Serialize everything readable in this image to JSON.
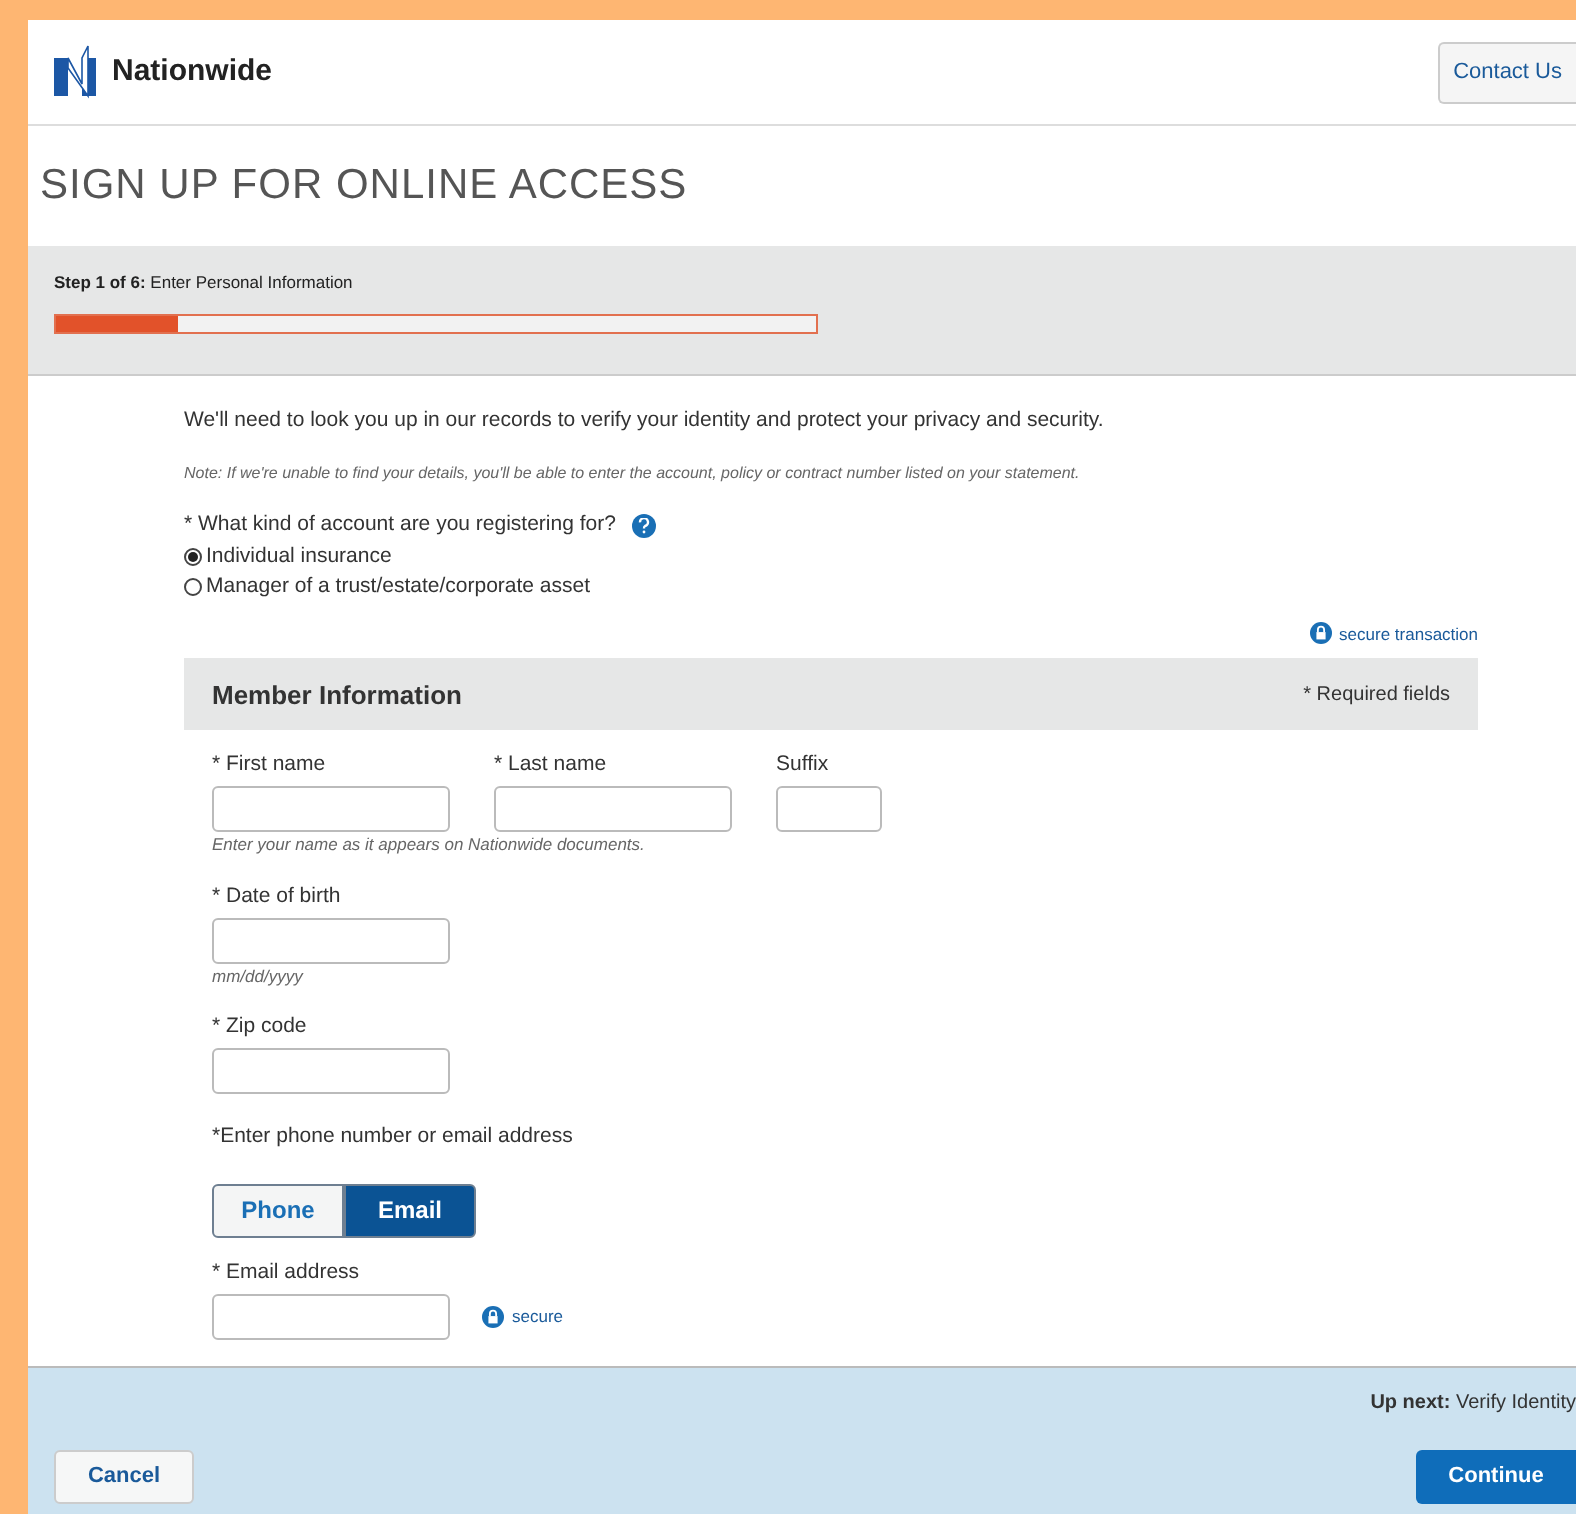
{
  "header": {
    "brand": "Nationwide",
    "contact_button": "Contact Us"
  },
  "title": "SIGN UP FOR ONLINE ACCESS",
  "progress": {
    "label": "**Step 1 of 6:** Enter Personal Information",
    "level": 0.16
  },
  "intro": "We'll need to look you up in our records to verify your identity and protect your privacy and security.",
  "note": "Note: If we're unable to find your details, you'll be able to enter the account, policy or contract number listed on your statement.",
  "account_question": "* What kind of account are you registering for?",
  "account_options": [
    {
      "label": "Individual insurance",
      "selected": true
    },
    {
      "label": "Manager of a trust/estate/corporate asset",
      "selected": false
    }
  ],
  "secure_transaction": "secure transaction",
  "panel": {
    "title": "Member Information",
    "required_note": "* Required fields"
  },
  "name_fields": [
    {
      "label": "* First name"
    },
    {
      "label": "* Last name"
    },
    {
      "label": "Suffix"
    }
  ],
  "name_hint": "Enter your name as it appears on Nationwide documents.",
  "dob": {
    "label": "* Date of birth",
    "hint": "mm/dd/yyyy"
  },
  "zip": {
    "label": "* Zip code"
  },
  "contact_prompt": "*Enter phone number or email address",
  "contact_toggle": [
    {
      "label": "Phone",
      "selected": false
    },
    {
      "label": "Email",
      "selected": true
    }
  ],
  "email": {
    "label": "* Email address",
    "secure": "secure"
  },
  "footer": {
    "up_next": "**Up next:** Verify Identity",
    "cancel": "Cancel",
    "continue": "Continue"
  }
}
